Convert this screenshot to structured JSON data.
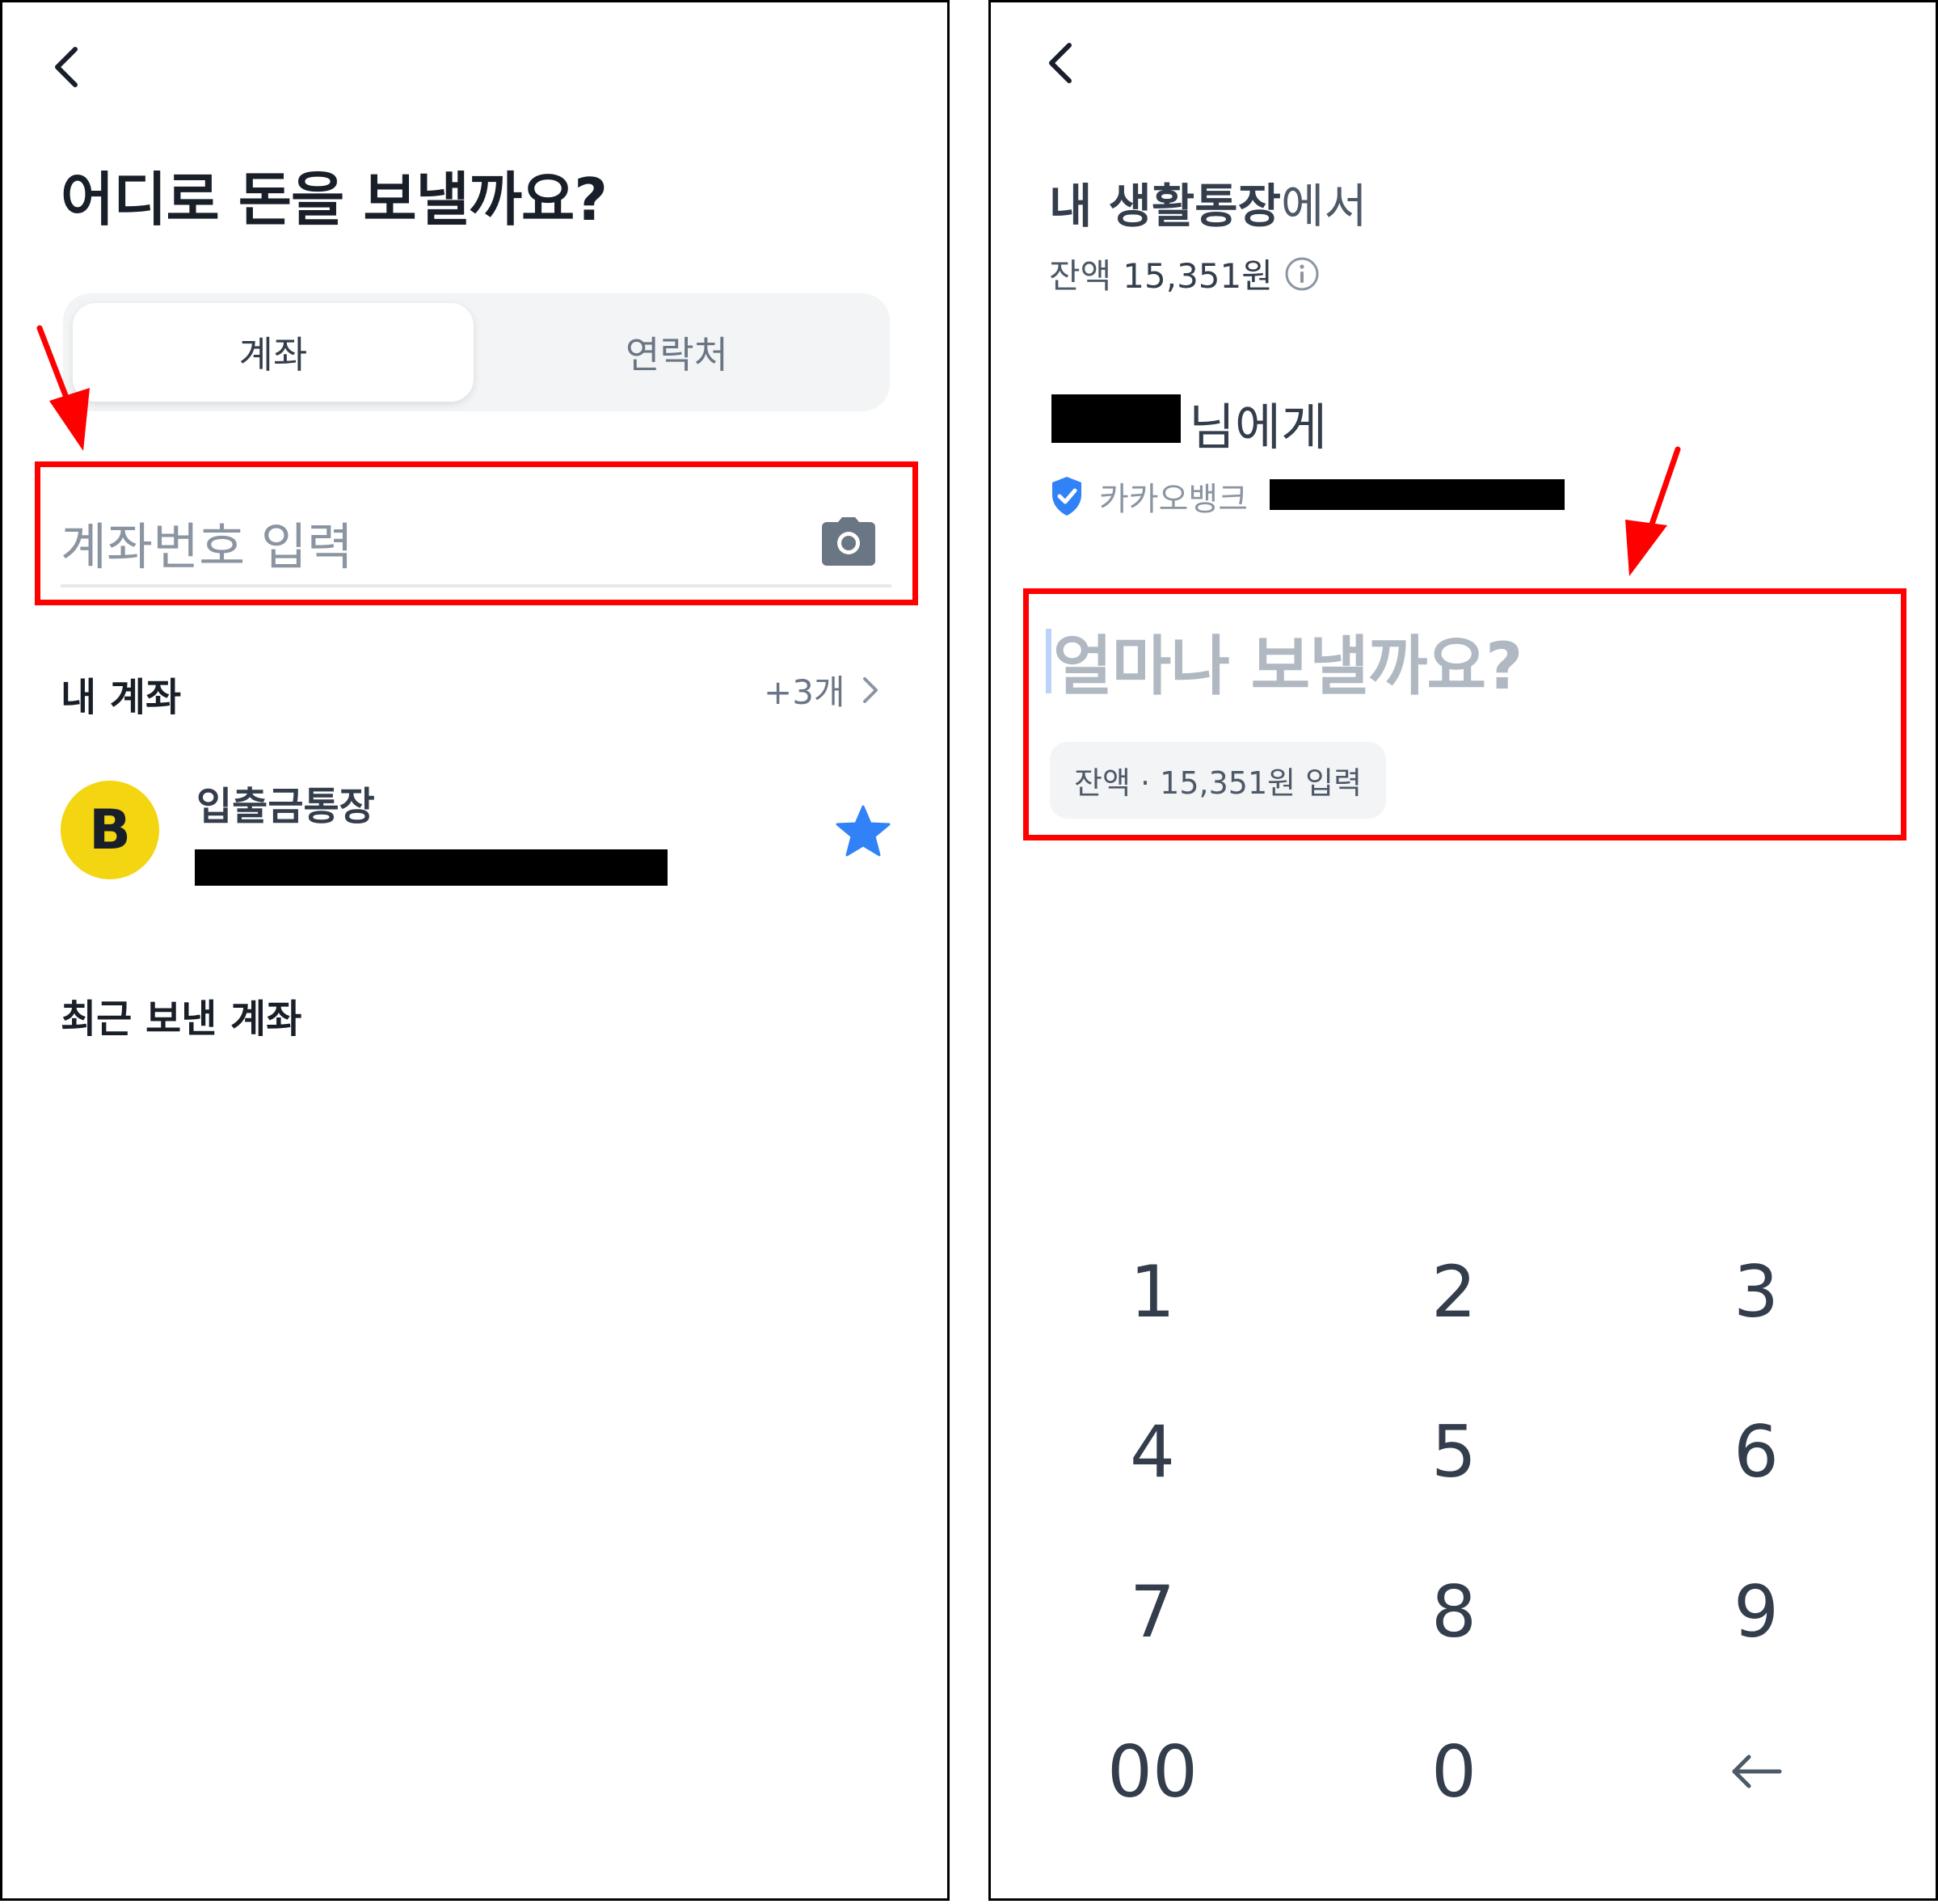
{
  "left_screen": {
    "back_icon": "chevron-left-icon",
    "title": "어디로 돈을 보낼까요?",
    "tabs": [
      {
        "label": "계좌",
        "active": true
      },
      {
        "label": "연락처",
        "active": false
      }
    ],
    "account_input": {
      "placeholder": "계좌번호 입력",
      "value": ""
    },
    "camera_icon": "camera-icon",
    "my_accounts": {
      "title": "내 계좌",
      "more_label": "+3개",
      "items": [
        {
          "logo_letter": "B",
          "logo_color": "#f4d511",
          "name": "입출금통장",
          "favorite": true
        }
      ]
    },
    "recent": {
      "title": "최근 보낸 계좌"
    }
  },
  "right_screen": {
    "back_icon": "chevron-left-icon",
    "from": {
      "account": "내 생활통장",
      "suffix": "에서"
    },
    "balance": {
      "label": "잔액",
      "amount": "15,351원"
    },
    "recipient": {
      "suffix": "님에게",
      "bank": "카카오뱅크"
    },
    "amount_input": {
      "placeholder": "얼마나 보낼까요?",
      "value": ""
    },
    "balance_chip": "잔액 · 15,351원 입력",
    "keypad": [
      "1",
      "2",
      "3",
      "4",
      "5",
      "6",
      "7",
      "8",
      "9",
      "00",
      "0",
      "←"
    ]
  },
  "colors": {
    "highlight": "#ff0000",
    "accent_blue": "#3182f6",
    "text_primary": "#191f28",
    "placeholder": "#8b95a1"
  }
}
